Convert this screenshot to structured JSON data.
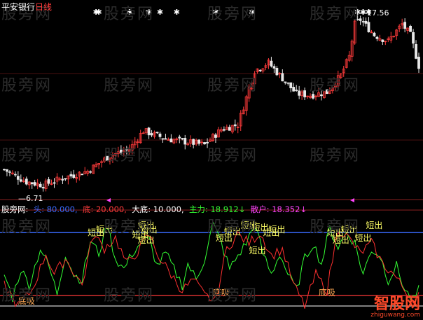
{
  "header": {
    "stock_name": "平安银行",
    "period": "日线",
    "low_price_label": "6.71",
    "high_price_label": "17.56"
  },
  "indicator": {
    "name": "股旁网",
    "params": [
      {
        "label": "头",
        "value": "80.000",
        "color": "#3a6bff"
      },
      {
        "label": "底",
        "value": "20.000",
        "color": "#ff3b3b"
      },
      {
        "label": "大底",
        "value": "10.000",
        "color": "#ffffff"
      },
      {
        "label": "主力",
        "value": "18.912",
        "color": "#33ff33",
        "arrow": "↓"
      },
      {
        "label": "散户",
        "value": "18.352",
        "color": "#ff44ff",
        "arrow": "↓"
      }
    ]
  },
  "watermark": "股旁网",
  "brand": {
    "name": "智股网",
    "url": "zhiguwang.com"
  },
  "signal_labels": {
    "short_exit": "短出",
    "bottom_buy": "底吸"
  },
  "colors": {
    "up": "#ff3b3b",
    "down": "#e8e8e8",
    "main_line": "#33ff33",
    "retail_line": "#ff3030",
    "top_line": "#3a6bff",
    "bottom_line": "#ff3b3b",
    "big_bottom_line": "#ffffff",
    "signal_text": "#ffff66",
    "star": "#ffffff",
    "marker": "#ff44ff"
  },
  "chart_data": [
    {
      "type": "candlestick",
      "title": "平安银行 日线",
      "n_bars": 150,
      "price_range": [
        6.0,
        18.5
      ],
      "low": 6.71,
      "high": 17.56,
      "anchors": [
        [
          0,
          7.9
        ],
        [
          8,
          7.1
        ],
        [
          14,
          6.9
        ],
        [
          22,
          7.4
        ],
        [
          30,
          7.8
        ],
        [
          38,
          8.8
        ],
        [
          45,
          9.2
        ],
        [
          50,
          10.4
        ],
        [
          58,
          9.9
        ],
        [
          65,
          9.7
        ],
        [
          72,
          9.5
        ],
        [
          78,
          10.5
        ],
        [
          84,
          10.8
        ],
        [
          90,
          14.3
        ],
        [
          95,
          14.8
        ],
        [
          100,
          13.8
        ],
        [
          105,
          12.8
        ],
        [
          110,
          12.7
        ],
        [
          116,
          12.9
        ],
        [
          121,
          14.0
        ],
        [
          124,
          15.2
        ],
        [
          126,
          17.3
        ],
        [
          128,
          17.6
        ],
        [
          133,
          16.6
        ],
        [
          138,
          16.2
        ],
        [
          143,
          17.3
        ],
        [
          146,
          16.6
        ],
        [
          149,
          14.6
        ]
      ],
      "star_signals": [
        33,
        34,
        45,
        52,
        56,
        62,
        76,
        89,
        127,
        129,
        131
      ]
    },
    {
      "type": "line",
      "title": "股旁网",
      "y_range": [
        0,
        100
      ],
      "levels": {
        "top": 80,
        "bottom": 20,
        "big_bottom": 10
      },
      "series": [
        {
          "name": "主力",
          "anchors": [
            [
              0,
              40
            ],
            [
              3,
              18
            ],
            [
              6,
              45
            ],
            [
              9,
              30
            ],
            [
              13,
              65
            ],
            [
              16,
              48
            ],
            [
              19,
              22
            ],
            [
              22,
              60
            ],
            [
              25,
              40
            ],
            [
              28,
              35
            ],
            [
              31,
              72
            ],
            [
              34,
              60
            ],
            [
              37,
              88
            ],
            [
              40,
              55
            ],
            [
              43,
              45
            ],
            [
              46,
              60
            ],
            [
              49,
              70
            ],
            [
              52,
              74
            ],
            [
              55,
              48
            ],
            [
              58,
              60
            ],
            [
              61,
              45
            ],
            [
              64,
              30
            ],
            [
              66,
              50
            ],
            [
              69,
              35
            ],
            [
              72,
              55
            ],
            [
              75,
              88
            ],
            [
              78,
              70
            ],
            [
              81,
              45
            ],
            [
              84,
              58
            ],
            [
              87,
              70
            ],
            [
              90,
              88
            ],
            [
              93,
              60
            ],
            [
              96,
              40
            ],
            [
              99,
              60
            ],
            [
              102,
              40
            ],
            [
              105,
              25
            ],
            [
              108,
              55
            ],
            [
              111,
              70
            ],
            [
              114,
              50
            ],
            [
              117,
              84
            ],
            [
              120,
              66
            ],
            [
              123,
              80
            ],
            [
              126,
              70
            ],
            [
              129,
              40
            ],
            [
              132,
              64
            ],
            [
              135,
              58
            ],
            [
              138,
              35
            ],
            [
              141,
              48
            ],
            [
              144,
              25
            ],
            [
              147,
              15
            ],
            [
              149,
              25
            ]
          ]
        },
        {
          "name": "散户",
          "anchors": [
            [
              0,
              30
            ],
            [
              5,
              10
            ],
            [
              10,
              25
            ],
            [
              15,
              60
            ],
            [
              18,
              40
            ],
            [
              22,
              55
            ],
            [
              28,
              30
            ],
            [
              32,
              78
            ],
            [
              36,
              65
            ],
            [
              40,
              75
            ],
            [
              44,
              50
            ],
            [
              48,
              62
            ],
            [
              52,
              78
            ],
            [
              56,
              55
            ],
            [
              60,
              40
            ],
            [
              64,
              25
            ],
            [
              68,
              35
            ],
            [
              72,
              20
            ],
            [
              76,
              15
            ],
            [
              80,
              65
            ],
            [
              84,
              78
            ],
            [
              88,
              70
            ],
            [
              92,
              80
            ],
            [
              96,
              58
            ],
            [
              100,
              64
            ],
            [
              104,
              30
            ],
            [
              108,
              10
            ],
            [
              112,
              40
            ],
            [
              116,
              25
            ],
            [
              120,
              84
            ],
            [
              124,
              74
            ],
            [
              128,
              60
            ],
            [
              132,
              70
            ],
            [
              136,
              50
            ],
            [
              140,
              40
            ],
            [
              144,
              25
            ],
            [
              148,
              15
            ],
            [
              149,
              20
            ]
          ]
        }
      ],
      "short_exit_signals": [
        [
          33,
          77
        ],
        [
          36,
          80
        ],
        [
          49,
          75
        ],
        [
          51,
          84
        ],
        [
          52,
          80
        ],
        [
          51,
          70
        ],
        [
          79,
          72
        ],
        [
          82,
          78
        ],
        [
          88,
          84
        ],
        [
          92,
          82
        ],
        [
          91,
          60
        ],
        [
          96,
          77
        ],
        [
          98,
          80
        ],
        [
          119,
          77
        ],
        [
          121,
          70
        ],
        [
          124,
          80
        ],
        [
          129,
          72
        ],
        [
          133,
          84
        ]
      ],
      "bottom_buy_signals": [
        [
          8,
          12
        ],
        [
          78,
          20
        ],
        [
          116,
          20
        ]
      ]
    }
  ]
}
